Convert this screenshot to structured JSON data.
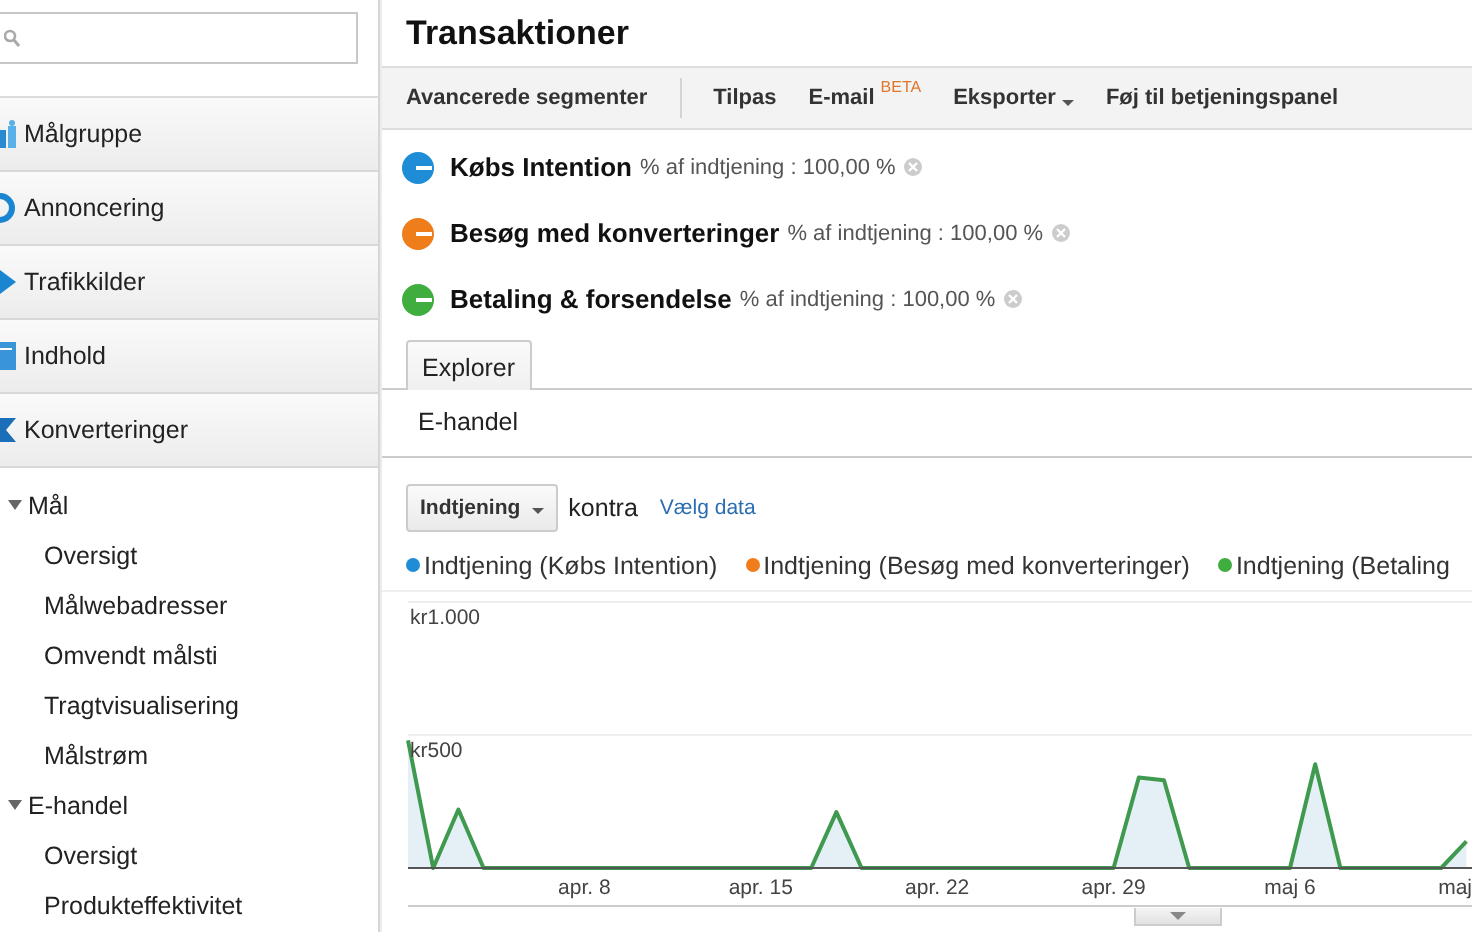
{
  "sidebar": {
    "items": [
      {
        "label": "Målgruppe"
      },
      {
        "label": "Annoncering"
      },
      {
        "label": "Trafikkilder"
      },
      {
        "label": "Indhold"
      },
      {
        "label": "Konverteringer"
      }
    ],
    "tree": [
      {
        "label": "Mål",
        "expanded": true,
        "children": [
          {
            "label": "Oversigt"
          },
          {
            "label": "Målwebadresser"
          },
          {
            "label": "Omvendt målsti"
          },
          {
            "label": "Tragtvisualisering"
          },
          {
            "label": "Målstrøm"
          }
        ]
      },
      {
        "label": "E-handel",
        "expanded": true,
        "children": [
          {
            "label": "Oversigt"
          },
          {
            "label": "Produkteffektivitet"
          }
        ]
      }
    ]
  },
  "main": {
    "title": "Transaktioner",
    "segments_button": "Avancerede segmenter",
    "toolbar": [
      {
        "label": "Tilpas",
        "kind": "button"
      },
      {
        "label": "E-mail",
        "badge": "BETA",
        "kind": "button"
      },
      {
        "label": "Eksporter",
        "kind": "menu"
      },
      {
        "label": "Føj til betjeningspanel",
        "kind": "button"
      }
    ],
    "segments": [
      {
        "name": "Købs Intention",
        "metric": "% af indtjening : 100,00 %",
        "color": "#1f8dd6"
      },
      {
        "name": "Besøg med konverteringer",
        "metric": "% af indtjening : 100,00 %",
        "color": "#ee7d1a"
      },
      {
        "name": "Betaling & forsendelse",
        "metric": "% af indtjening : 100,00 %",
        "color": "#3fae3f"
      }
    ],
    "tabs": [
      {
        "label": "Explorer",
        "selected": true
      }
    ],
    "subtab": "E-handel",
    "metric_select": "Indtjening",
    "versus": "kontra",
    "choose_link": "Vælg data",
    "legend": [
      {
        "label": "Indtjening (Købs Intention)",
        "color": "#1f8dd6"
      },
      {
        "label": "Indtjening (Besøg med konverteringer)",
        "color": "#ee7d1a"
      },
      {
        "label": "Indtjening (Betaling",
        "color": "#3fae3f"
      }
    ],
    "chart": {
      "y_labels": [
        "kr1.000",
        "kr500"
      ],
      "x_labels": [
        "apr. 8",
        "apr. 15",
        "apr. 22",
        "apr. 29",
        "maj 6",
        "maj"
      ]
    }
  }
}
